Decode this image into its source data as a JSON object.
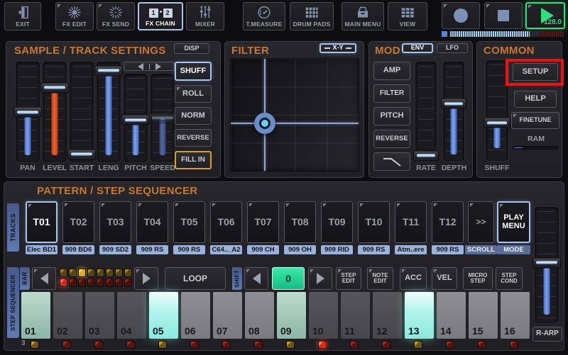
{
  "colors": {
    "accent_blue": "#a6c6ee",
    "accent_orange": "#c8772e",
    "play_green": "#2ce27c",
    "fill_in_border": "#d8a31c",
    "setup_highlight_red": "#ee1010",
    "step_active_cyan": "#8aeade",
    "step_active_dim": "#8cb6a7",
    "slider_blue": "#7fa4f0",
    "slider_orange": "#f06030",
    "badge_blue": "#9db2d8"
  },
  "toolbar": {
    "items": [
      "EXIT",
      "FX EDIT",
      "FX SEND",
      "FX CHAIN",
      "MIXER",
      "T.MEASURE",
      "DRUM PADS",
      "MAIN MENU",
      "VIEW"
    ],
    "fx_chain_badges": [
      "1",
      "2"
    ],
    "tempo": "128.0"
  },
  "sample_panel": {
    "title": "SAMPLE / TRACK SETTINGS",
    "disp": "DISP",
    "slider_labels": [
      "PAN",
      "LEVEL",
      "START",
      "LENG",
      "PITCH",
      "SPEED"
    ],
    "buttons": [
      "SHUFF",
      "ROLL",
      "NORM",
      "REVERSE",
      "FILL IN"
    ]
  },
  "filter_panel": {
    "title": "FILTER",
    "mode": "X-Y"
  },
  "mod_panel": {
    "title": "MOD",
    "tabs": [
      "ENV",
      "LFO"
    ],
    "buttons": [
      "AMP",
      "FILTER",
      "PITCH",
      "REVERSE"
    ],
    "slider_labels": [
      "RATE",
      "DEPTH"
    ]
  },
  "common_panel": {
    "title": "COMMON",
    "setup": "SETUP",
    "help": "HELP",
    "finetune": "FINETUNE",
    "ram": "RAM",
    "shuff": "SHUFF"
  },
  "sequencer": {
    "title": "PATTERN / STEP SEQUENCER",
    "tracks_tab": "TRACKS",
    "stepseq_tab": "STEP SEQUENCER",
    "tracks": [
      {
        "id": "T01",
        "sample": "Elec BD1"
      },
      {
        "id": "T02",
        "sample": "909 BD6"
      },
      {
        "id": "T03",
        "sample": "909 SD2"
      },
      {
        "id": "T04",
        "sample": "909 RS"
      },
      {
        "id": "T05",
        "sample": "909 RS"
      },
      {
        "id": "T06",
        "sample": "C64.._A2"
      },
      {
        "id": "T07",
        "sample": "909 CH"
      },
      {
        "id": "T08",
        "sample": "909 OH"
      },
      {
        "id": "T09",
        "sample": "909 RID"
      },
      {
        "id": "T10",
        "sample": "909 RS"
      },
      {
        "id": "T11",
        "sample": "Atm..ere"
      },
      {
        "id": "T12",
        "sample": "909 RS"
      }
    ],
    "scroll_btn": ">>",
    "scroll_label": "SCROLL",
    "play_menu": "PLAY MENU",
    "mode_label": "MODE",
    "bar_tab": "BAR",
    "shift_tab": "SHIFT",
    "loop": "LOOP",
    "shift_value": "0",
    "controls": [
      "STEP EDIT",
      "NOTE EDIT",
      "ACC",
      "VEL",
      "MICRO STEP",
      "STEP COND"
    ],
    "steps": [
      "01",
      "02",
      "03",
      "04",
      "05",
      "06",
      "07",
      "08",
      "09",
      "10",
      "11",
      "12",
      "13",
      "14",
      "15",
      "16"
    ],
    "active_steps": [
      "01",
      "05",
      "09",
      "13"
    ],
    "bar_number": "3",
    "rarp": "R-ARP"
  }
}
